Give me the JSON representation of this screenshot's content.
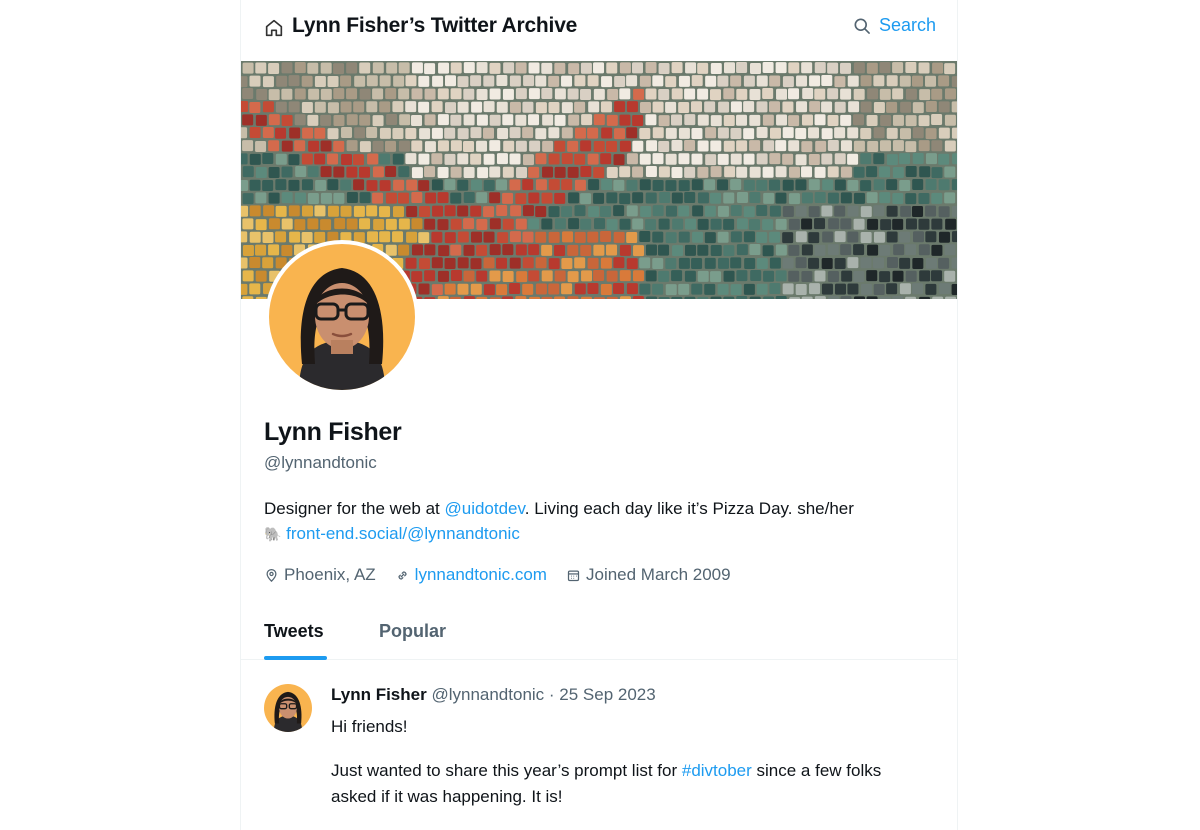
{
  "header": {
    "title": "Lynn Fisher’s Twitter Archive",
    "search_label": "Search"
  },
  "profile": {
    "name": "Lynn Fisher",
    "handle": "@lynnandtonic",
    "bio_prefix": "Designer for the web at ",
    "bio_mention": "@uidotdev",
    "bio_suffix": ". Living each day like it’s Pizza Day. she/her",
    "bio_emoji": "🐘",
    "bio_link": "front-end.social/@lynnandtonic",
    "location": "Phoenix, AZ",
    "website": "lynnandtonic.com",
    "joined": "Joined March 2009"
  },
  "tabs": [
    {
      "label": "Tweets",
      "active": true
    },
    {
      "label": "Popular",
      "active": false
    }
  ],
  "tweet": {
    "author": "Lynn Fisher",
    "handle": "@lynnandtonic",
    "separator": " · ",
    "date": "25 Sep 2023",
    "line1": "Hi friends!",
    "line2_prefix": "Just wanted to share this year’s prompt list for ",
    "line2_hashtag": "#divtober",
    "line2_suffix": " since a few folks asked if it was happening. It is!"
  },
  "colors": {
    "accent": "#1d9bf0",
    "secondary_text": "#536471",
    "avatar_bg": "#f9b44f"
  },
  "icons": {
    "home": "home-icon",
    "search": "search-icon",
    "location": "location-pin-icon",
    "link": "link-icon",
    "calendar": "calendar-icon"
  }
}
